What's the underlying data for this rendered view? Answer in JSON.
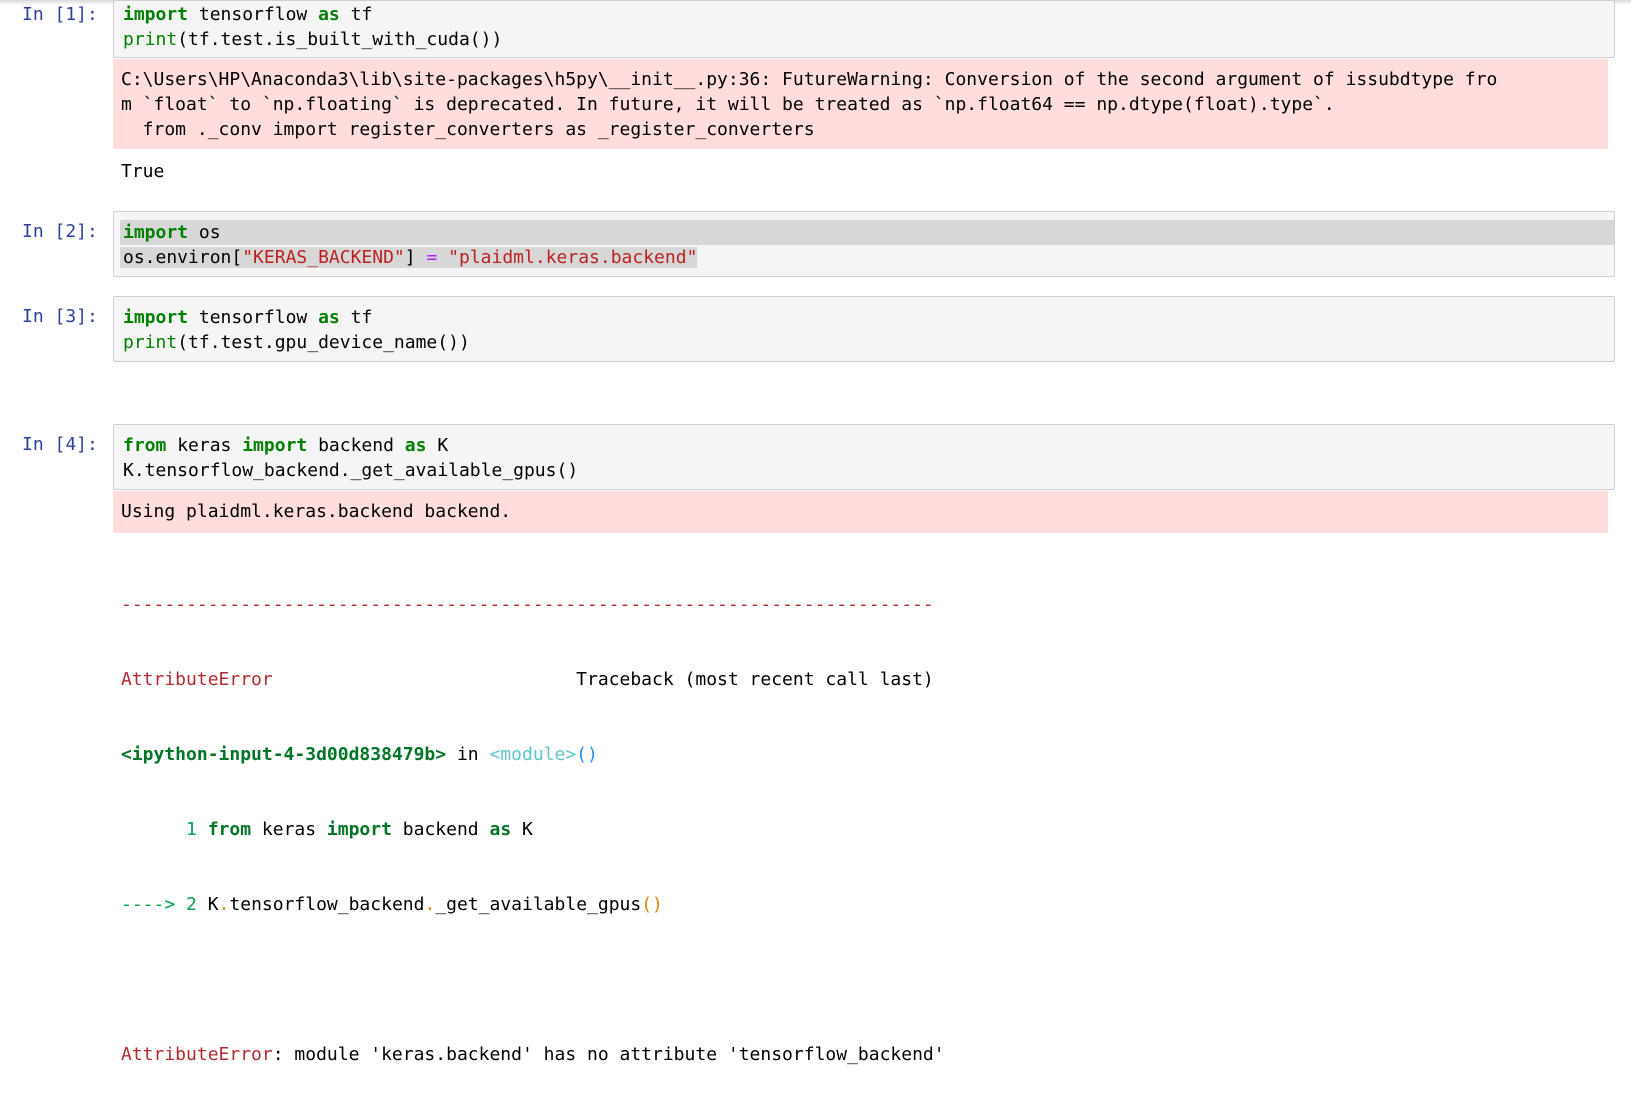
{
  "cells": [
    {
      "prompt": "In [1]:",
      "code": [
        [
          {
            "t": "import",
            "c": "kw"
          },
          {
            "t": " tensorflow "
          },
          {
            "t": "as",
            "c": "kw"
          },
          {
            "t": " tf"
          }
        ],
        [
          {
            "t": "print",
            "c": "bi"
          },
          {
            "t": "(tf.test.is_built_with_cuda())"
          }
        ]
      ],
      "stderr": [
        "C:\\Users\\HP\\Anaconda3\\lib\\site-packages\\h5py\\__init__.py:36: FutureWarning: Conversion of the second argument of issubdtype fro",
        "m `float` to `np.floating` is deprecated. In future, it will be treated as `np.float64 == np.dtype(float).type`.",
        "  from ._conv import register_converters as _register_converters"
      ],
      "stdout": "True"
    },
    {
      "prompt": "In [2]:",
      "code": [
        [
          {
            "t": "import",
            "c": "kw"
          },
          {
            "t": " os"
          }
        ],
        [
          {
            "t": "os.environ["
          },
          {
            "t": "\"KERAS_BACKEND\"",
            "c": "str"
          },
          {
            "t": "] "
          },
          {
            "t": "=",
            "c": "op"
          },
          {
            "t": " "
          },
          {
            "t": "\"plaidml.keras.backend\"",
            "c": "str"
          }
        ]
      ]
    },
    {
      "prompt": "In [3]:",
      "code": [
        [
          {
            "t": "import",
            "c": "kw"
          },
          {
            "t": " tensorflow "
          },
          {
            "t": "as",
            "c": "kw"
          },
          {
            "t": " tf"
          }
        ],
        [
          {
            "t": "print",
            "c": "bi"
          },
          {
            "t": "(tf.test.gpu_device_name())"
          }
        ]
      ]
    },
    {
      "prompt": "In [4]:",
      "code": [
        [
          {
            "t": "from",
            "c": "kw"
          },
          {
            "t": " keras "
          },
          {
            "t": "import",
            "c": "kw"
          },
          {
            "t": " backend "
          },
          {
            "t": "as",
            "c": "kw"
          },
          {
            "t": " K"
          }
        ],
        [
          {
            "t": "K.tensorflow_backend._get_available_gpus()"
          }
        ]
      ],
      "stderr": [
        "Using plaidml.keras.backend backend."
      ],
      "traceback": [
        [
          {
            "t": "---------------------------------------------------------------------------",
            "c": "red"
          }
        ],
        [
          {
            "t": "AttributeError",
            "c": "red"
          },
          {
            "t": "                            Traceback (most recent call last)"
          }
        ],
        [
          {
            "t": "<ipython-input-4-3d00d838479b>",
            "c": "grnb"
          },
          {
            "t": " in "
          },
          {
            "t": "<module>",
            "c": "cyan"
          },
          {
            "t": "()",
            "c": "blue"
          }
        ],
        [
          {
            "t": "      1 ",
            "c": "grn"
          },
          {
            "t": "from",
            "c": "grnb"
          },
          {
            "t": " keras "
          },
          {
            "t": "import",
            "c": "grnb"
          },
          {
            "t": " backend "
          },
          {
            "t": "as",
            "c": "grnb"
          },
          {
            "t": " K"
          }
        ],
        [
          {
            "t": "----> 2 ",
            "c": "grn"
          },
          {
            "t": "K"
          },
          {
            "t": ".",
            "c": "yel"
          },
          {
            "t": "tensorflow_backend"
          },
          {
            "t": ".",
            "c": "yel"
          },
          {
            "t": "_get_available_gpus"
          },
          {
            "t": "()",
            "c": "yel"
          }
        ],
        [
          {
            "t": ""
          }
        ],
        [
          {
            "t": "AttributeError",
            "c": "red"
          },
          {
            "t": ": module 'keras.backend' has no attribute 'tensorflow_backend'"
          }
        ]
      ]
    }
  ]
}
